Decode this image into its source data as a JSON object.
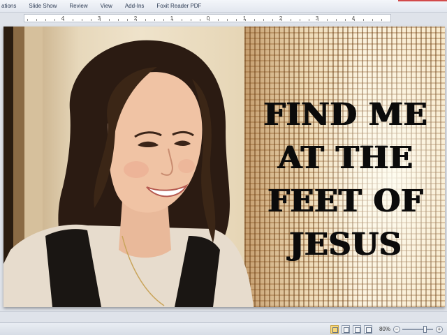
{
  "ribbon": {
    "tabs": [
      "ations",
      "Slide Show",
      "Review",
      "View",
      "Add-Ins",
      "Foxit Reader PDF"
    ]
  },
  "ruler": {
    "labels": [
      "4",
      "3",
      "2",
      "1",
      "0",
      "1",
      "2",
      "3",
      "4"
    ]
  },
  "slide": {
    "caption_lines": [
      "FIND ME",
      "AT THE",
      "FEET OF",
      "JESUS"
    ],
    "image": "photo of smiling woman with long dark hair by a window with woven blinds"
  },
  "status": {
    "zoom": "80%",
    "zoom_level": 0.8,
    "view_buttons": [
      "normal-view-icon",
      "slide-sorter-icon",
      "reading-view-icon",
      "slideshow-icon"
    ]
  }
}
